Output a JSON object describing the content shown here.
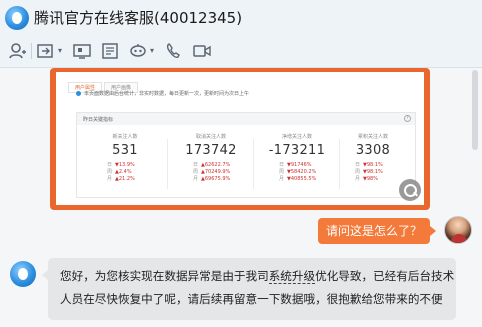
{
  "window": {
    "title": "腾讯官方在线客服(40012345)"
  },
  "toolbar": {
    "icons": [
      "contact-icon",
      "transfer-icon",
      "screen-icon",
      "document-icon",
      "robot-icon",
      "phone-icon",
      "video-icon"
    ]
  },
  "screenshot": {
    "tabs": [
      "用户属性",
      "用户画像"
    ],
    "note": "本页面数据由后台统计，非实时数据，每日更新一次，更新时间为次日上午",
    "card_title": "昨日关键指标",
    "help": "?",
    "metrics": [
      {
        "label": "新关注人数",
        "value": "531",
        "rows": [
          [
            "日",
            "▼13.9%"
          ],
          [
            "周",
            "▲2.4%"
          ],
          [
            "月",
            "▲21.2%"
          ]
        ]
      },
      {
        "label": "取消关注人数",
        "value": "173742",
        "rows": [
          [
            "日",
            "▲62622.7%"
          ],
          [
            "周",
            "▲70249.9%"
          ],
          [
            "月",
            "▲69675.9%"
          ]
        ]
      },
      {
        "label": "净增关注人数",
        "value": "-173211",
        "rows": [
          [
            "日",
            "▼91746%"
          ],
          [
            "周",
            "▼58420.2%"
          ],
          [
            "月",
            "▼40855.5%"
          ]
        ]
      },
      {
        "label": "累积关注人数",
        "value": "3308",
        "rows": [
          [
            "日",
            "▼98.1%"
          ],
          [
            "周",
            "▼98.1%"
          ],
          [
            "月",
            "▼98%"
          ]
        ]
      }
    ]
  },
  "messages": {
    "outgoing": "请问这是怎么了？",
    "incoming": {
      "line1_a": "您好，为您核实现在数据异常是由于我司",
      "line1_u": "系统升级",
      "line1_b": "优化导致，已经有后台技术",
      "line2": "人员在尽快恢复中了呢，请后续再留意一下数据哦，很抱歉给您带来的不便"
    }
  },
  "colors": {
    "accent": "#f37a3a",
    "frame": "#e9672d",
    "brand": "#2e8fe0"
  }
}
